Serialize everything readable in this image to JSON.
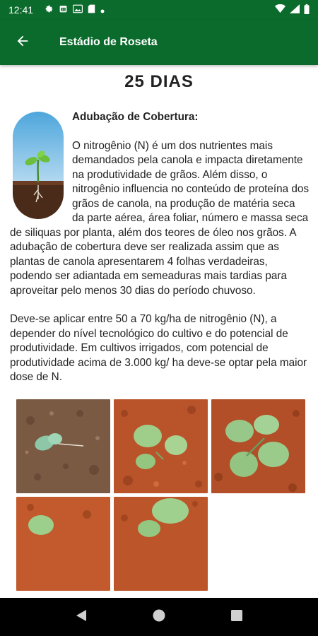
{
  "status_bar": {
    "time": "12:41",
    "icons": [
      "gear-icon",
      "calendar-icon",
      "image-icon",
      "sd-card-icon",
      "dot-icon"
    ],
    "right_icons": [
      "wifi-icon",
      "signal-icon",
      "battery-icon"
    ]
  },
  "app_bar": {
    "title": "Estádio de Roseta",
    "back_icon": "arrow-left-icon"
  },
  "main": {
    "days_title": "25 DIAS",
    "section_title": "Adubação de Cobertura:",
    "paragraph1": "O nitrogênio (N) é um dos nutrientes mais demandados pela canola e impacta diretamente na produtividade de grãos. Além disso, o nitrogênio influencia no conteúdo de proteína dos grãos de canola, na produção de matéria seca da parte aérea, área foliar, número e massa seca de siliquas por planta, além dos teores de óleo nos grãos. A adubação de cobertura deve ser realizada assim que as plantas de canola apresentarem 4 folhas verdadeiras, podendo ser adiantada em semeaduras mais tardias para aproveitar pelo menos 30 dias do período chuvoso.",
    "paragraph2": "Deve-se aplicar entre 50 a 70 kg/ha de nitrogênio (N), a depender do nível tecnológico do cultivo e do potencial de produtividade. Em cultivos irrigados, com potencial de produtividade acima de 3.000 kg/ ha deve-se optar pela maior dose de N.",
    "photos": [
      "seedling-photo-1",
      "seedling-photo-2",
      "seedling-photo-3",
      "seedling-photo-4",
      "seedling-photo-5"
    ]
  },
  "nav_bar": {
    "buttons": [
      "back-triangle-icon",
      "home-circle-icon",
      "recents-square-icon"
    ]
  },
  "colors": {
    "primary": "#0b6b2c",
    "soil": "#b9542a",
    "leaf": "#8fc27a"
  }
}
